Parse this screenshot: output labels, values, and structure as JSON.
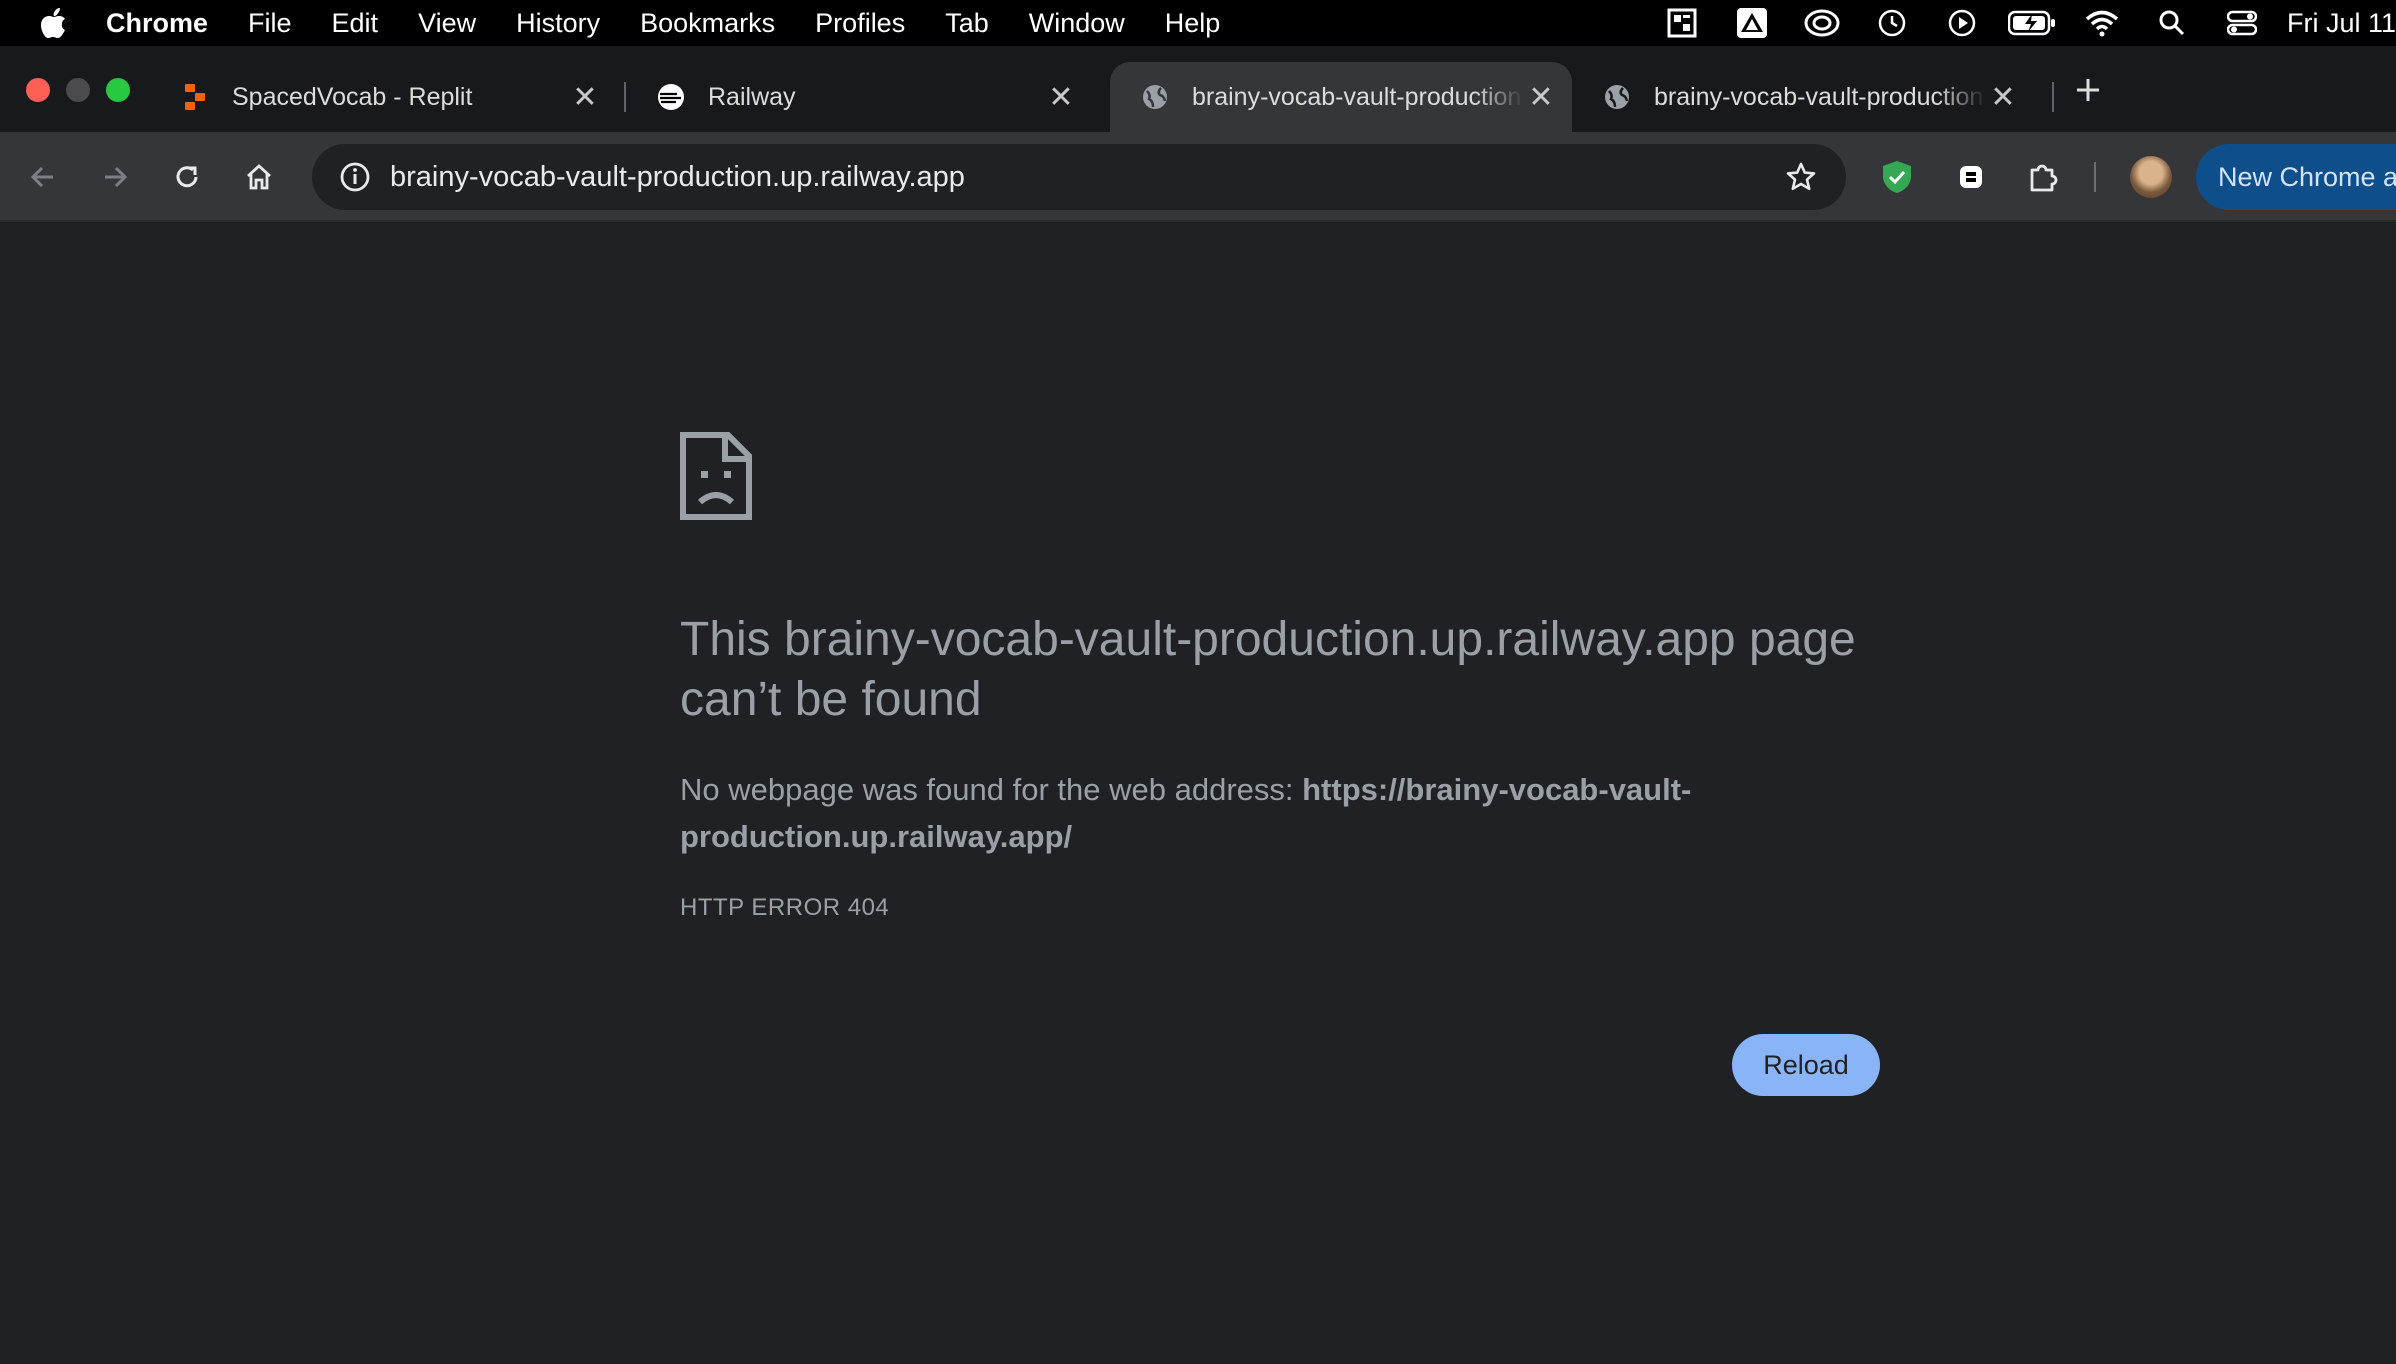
{
  "menubar": {
    "app_name": "Chrome",
    "items": [
      "File",
      "Edit",
      "View",
      "History",
      "Bookmarks",
      "Profiles",
      "Tab",
      "Window",
      "Help"
    ],
    "clock": "Fri Jul 11"
  },
  "tabs": [
    {
      "title": "SpacedVocab - Replit",
      "favicon": "replit-icon",
      "active": false
    },
    {
      "title": "Railway",
      "favicon": "railway-icon",
      "active": false
    },
    {
      "title": "brainy-vocab-vault-production.up.railway.app",
      "favicon": "globe-icon",
      "active": true
    },
    {
      "title": "brainy-vocab-vault-production.up.railway.app",
      "favicon": "globe-icon",
      "active": false
    }
  ],
  "toolbar": {
    "url": "brainy-vocab-vault-production.up.railway.app",
    "new_chrome_label": "New Chrome available"
  },
  "error_page": {
    "title": "This brainy-vocab-vault-production.up.railway.app page can’t be found",
    "desc_prefix": "No webpage was found for the web address: ",
    "desc_url": "https://brainy-vocab-vault-production.up.railway.app/",
    "code": "HTTP ERROR 404",
    "reload_label": "Reload"
  },
  "colors": {
    "page_bg": "#202124",
    "text_muted": "#9aa0a6",
    "reload_bg": "#8ab4f8",
    "new_chrome_bg": "#0e4f8b"
  }
}
